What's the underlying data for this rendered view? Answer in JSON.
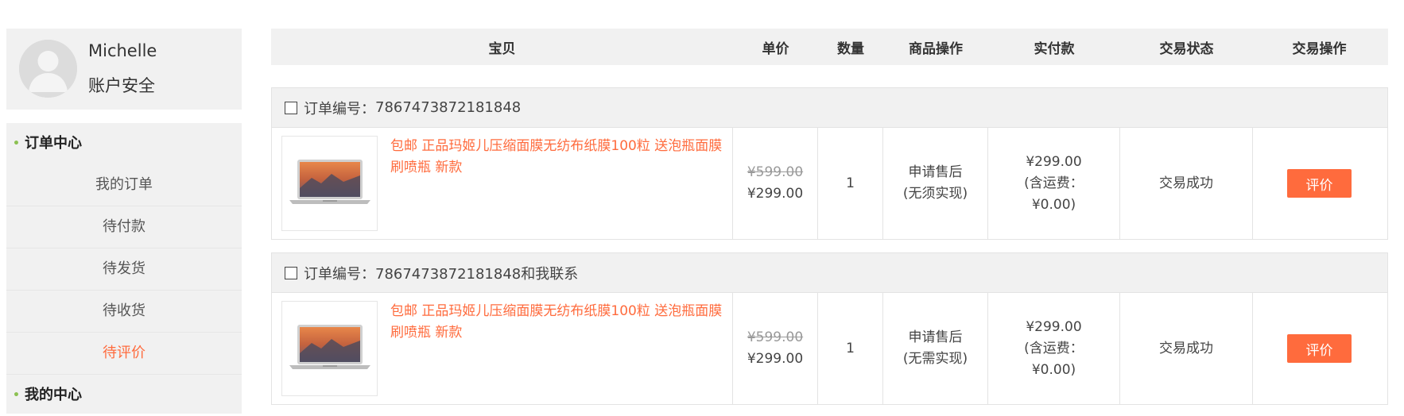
{
  "user": {
    "name": "Michelle",
    "security_label": "账户安全"
  },
  "menu": {
    "order_center_label": "订单中心",
    "items": [
      {
        "label": "我的订单"
      },
      {
        "label": "待付款"
      },
      {
        "label": "待发货"
      },
      {
        "label": "待收货"
      },
      {
        "label": "待评价"
      }
    ],
    "my_center_label": "我的中心"
  },
  "table": {
    "headers": [
      "宝贝",
      "单价",
      "数量",
      "商品操作",
      "实付款",
      "交易状态",
      "交易操作"
    ]
  },
  "orders": [
    {
      "order_no_label": "订单编号：",
      "order_no": "7867473872181848",
      "product_title": "包邮 正品玛姬儿压缩面膜无纺布纸膜100粒 送泡瓶面膜刷喷瓶 新款",
      "original_price": "¥599.00",
      "price": "¥299.00",
      "quantity": "1",
      "operation": "申请售后(无须实现)",
      "paid": "¥299.00",
      "shipping": "(含运费：¥0.00)",
      "status": "交易成功",
      "action_label": "评价"
    },
    {
      "order_no_label": "订单编号：",
      "order_no": "7867473872181848和我联系",
      "product_title": "包邮 正品玛姬儿压缩面膜无纺布纸膜100粒 送泡瓶面膜刷喷瓶 新款",
      "original_price": "¥599.00",
      "price": "¥299.00",
      "quantity": "1",
      "operation": "申请售后(无需实现)",
      "paid": "¥299.00",
      "shipping": "(含运费：¥0.00)",
      "status": "交易成功",
      "action_label": "评价"
    }
  ],
  "colors": {
    "accent": "#ff6b3d",
    "bullet": "#8cc152",
    "panel": "#f1f1f1"
  }
}
